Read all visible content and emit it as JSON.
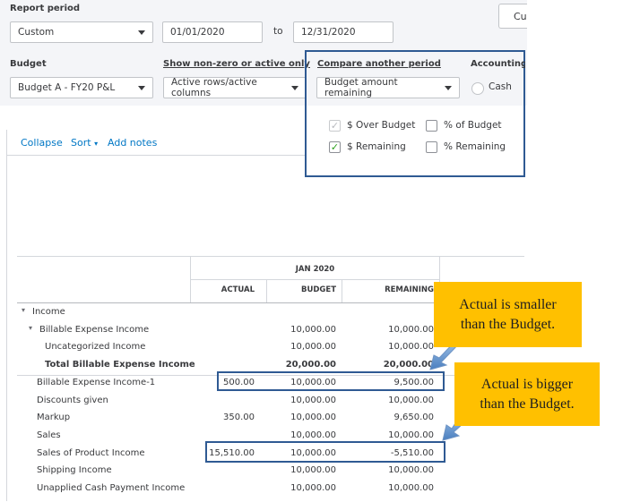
{
  "filters": {
    "report_period_label": "Report period",
    "report_period_value": "Custom",
    "date_from": "01/01/2020",
    "to_label": "to",
    "date_to": "12/31/2020",
    "customize_button_partial": "Cu",
    "budget_label": "Budget",
    "budget_value": "Budget A - FY20 P&L",
    "show_nonzero_label": "Show non-zero or active only",
    "show_nonzero_value": "Active rows/active columns",
    "compare_label": "Compare another period",
    "compare_value": "Budget amount remaining",
    "accounting_label_partial": "Accounting m",
    "cash_label": "Cash"
  },
  "compare_options": [
    {
      "label": "$ Over Budget",
      "state": "disabled-checked"
    },
    {
      "label": "% of Budget",
      "state": "unchecked"
    },
    {
      "label": "$ Remaining",
      "state": "checked"
    },
    {
      "label": "% Remaining",
      "state": "unchecked"
    }
  ],
  "toolbar": {
    "collapse": "Collapse",
    "sort": "Sort",
    "add_notes": "Add notes"
  },
  "report": {
    "period_header": "JAN 2020",
    "columns": [
      "ACTUAL",
      "BUDGET",
      "REMAINING"
    ],
    "rows": [
      {
        "label": "Income",
        "indent": 0,
        "caret": true,
        "bold": false,
        "actual": "",
        "budget": "",
        "remaining": ""
      },
      {
        "label": "Billable Expense Income",
        "indent": 1,
        "caret": true,
        "bold": false,
        "actual": "",
        "budget": "10,000.00",
        "remaining": "10,000.00"
      },
      {
        "label": "Uncategorized Income",
        "indent": 2,
        "caret": false,
        "bold": false,
        "actual": "",
        "budget": "10,000.00",
        "remaining": "10,000.00"
      },
      {
        "label": "Total Billable Expense Income",
        "indent": 2,
        "caret": false,
        "bold": true,
        "actual": "",
        "budget": "20,000.00",
        "remaining": "20,000.00"
      },
      {
        "label": "Billable Expense Income-1",
        "indent": 1,
        "caret": false,
        "bold": false,
        "actual": "500.00",
        "budget": "10,000.00",
        "remaining": "9,500.00"
      },
      {
        "label": "Discounts given",
        "indent": 1,
        "caret": false,
        "bold": false,
        "actual": "",
        "budget": "10,000.00",
        "remaining": "10,000.00"
      },
      {
        "label": "Markup",
        "indent": 1,
        "caret": false,
        "bold": false,
        "actual": "350.00",
        "budget": "10,000.00",
        "remaining": "9,650.00"
      },
      {
        "label": "Sales",
        "indent": 1,
        "caret": false,
        "bold": false,
        "actual": "",
        "budget": "10,000.00",
        "remaining": "10,000.00"
      },
      {
        "label": "Sales of Product Income",
        "indent": 1,
        "caret": false,
        "bold": false,
        "actual": "15,510.00",
        "budget": "10,000.00",
        "remaining": "-5,510.00"
      },
      {
        "label": "Shipping Income",
        "indent": 1,
        "caret": false,
        "bold": false,
        "actual": "",
        "budget": "10,000.00",
        "remaining": "10,000.00"
      },
      {
        "label": "Unapplied Cash Payment Income",
        "indent": 1,
        "caret": false,
        "bold": false,
        "actual": "",
        "budget": "10,000.00",
        "remaining": "10,000.00"
      }
    ]
  },
  "callouts": {
    "smaller": [
      "Actual is smaller",
      "than the Budget."
    ],
    "bigger": [
      "Actual is bigger",
      "than the Budget."
    ]
  },
  "colors": {
    "highlight_border": "#2f5a93",
    "callout_fill": "#ffc000",
    "link": "#0077c5",
    "check": "#2ca01c"
  }
}
